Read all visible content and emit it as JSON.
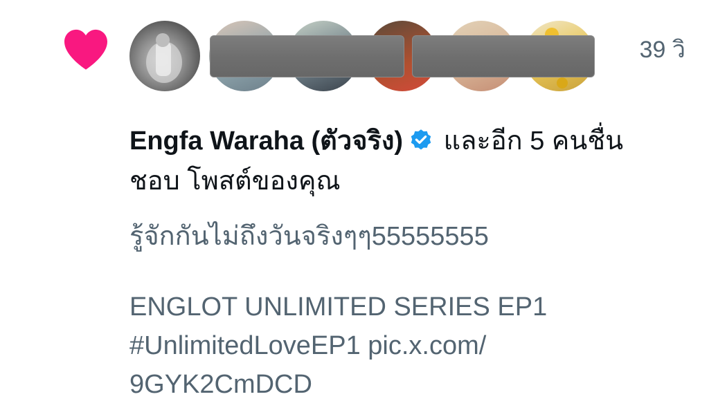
{
  "notification": {
    "type_icon": "heart-icon",
    "heart_color": "#f91880",
    "timestamp": "39 วิ",
    "avatars": [
      {
        "name": "avatar-1",
        "redacted": false
      },
      {
        "name": "avatar-2",
        "redacted": true
      },
      {
        "name": "avatar-3",
        "redacted": true
      },
      {
        "name": "avatar-4",
        "redacted": true
      },
      {
        "name": "avatar-5",
        "redacted": true
      },
      {
        "name": "avatar-6",
        "redacted": false
      }
    ],
    "actor_name": "Engfa Waraha (ตัวจริง)",
    "verified_icon": "verified-badge-icon",
    "verified_color": "#1d9bf0",
    "action_text_1": " และอีก 5 คนชื่น",
    "action_text_2": "ชอบ โพสต์ของคุณ",
    "post": {
      "line1": "รู้จักกันไม่ถึงวันจริงๆๆ55555555",
      "line2": "ENGLOT UNLIMITED SERIES EP1",
      "line3": "#UnlimitedLoveEP1 pic.x.com/",
      "line4": "9GYK2CmDCD"
    },
    "text_color_primary": "#0f1419",
    "text_color_secondary": "#536471"
  }
}
